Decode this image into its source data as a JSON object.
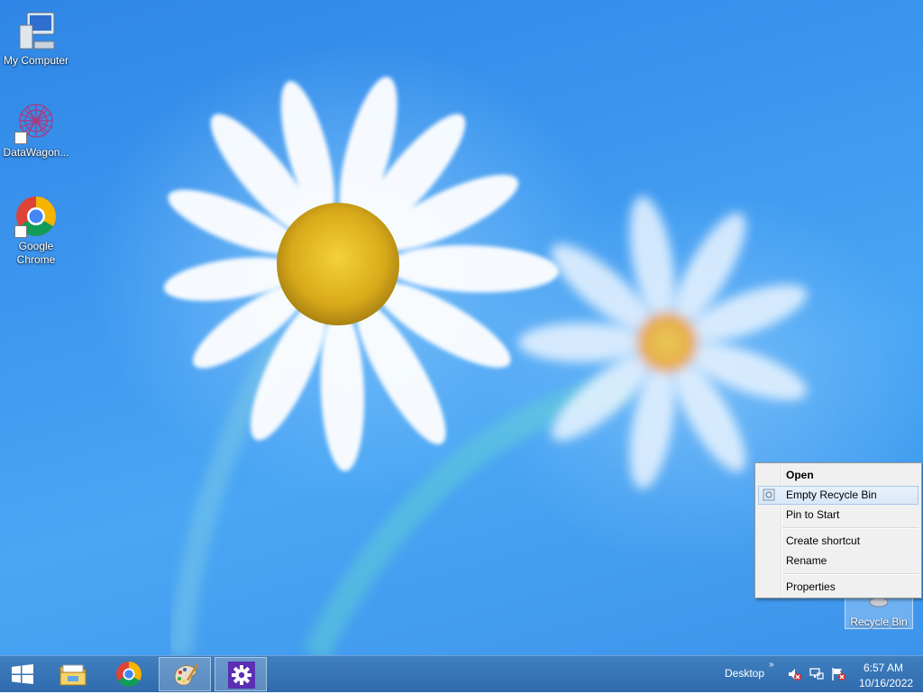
{
  "desktop": {
    "icons": [
      {
        "label": "My Computer",
        "icon": "computer-icon"
      },
      {
        "label": "DataWagon...",
        "icon": "datawagon-icon"
      },
      {
        "label": "Google Chrome",
        "icon": "chrome-icon"
      },
      {
        "label": "Recycle Bin",
        "icon": "recycle-bin-icon"
      }
    ]
  },
  "context_menu": {
    "items": [
      {
        "label": "Open",
        "bold": true
      },
      {
        "label": "Empty Recycle Bin",
        "highlighted": true,
        "icon": "shield-icon"
      },
      {
        "label": "Pin to Start"
      },
      {
        "label": "Create shortcut"
      },
      {
        "label": "Rename"
      },
      {
        "label": "Properties"
      }
    ]
  },
  "taskbar": {
    "start_icon": "windows-logo-icon",
    "pinned": [
      {
        "name": "file-explorer",
        "icon": "folder-icon"
      },
      {
        "name": "google-chrome",
        "icon": "chrome-icon"
      },
      {
        "name": "paint",
        "icon": "palette-icon",
        "active": true
      },
      {
        "name": "settings",
        "icon": "gear-icon",
        "active": true
      }
    ],
    "toolbar_label": "Desktop",
    "chevron": "»",
    "tray": [
      "volume-muted-icon",
      "network-icon",
      "action-center-flag-icon"
    ],
    "clock": {
      "time": "6:57 AM",
      "date": "10/16/2022"
    }
  },
  "colors": {
    "taskbar": "#2f6bad",
    "menu_background": "#f0f0f0",
    "menu_highlight": "#d9e8f8",
    "desktop": "#3d98f0"
  }
}
